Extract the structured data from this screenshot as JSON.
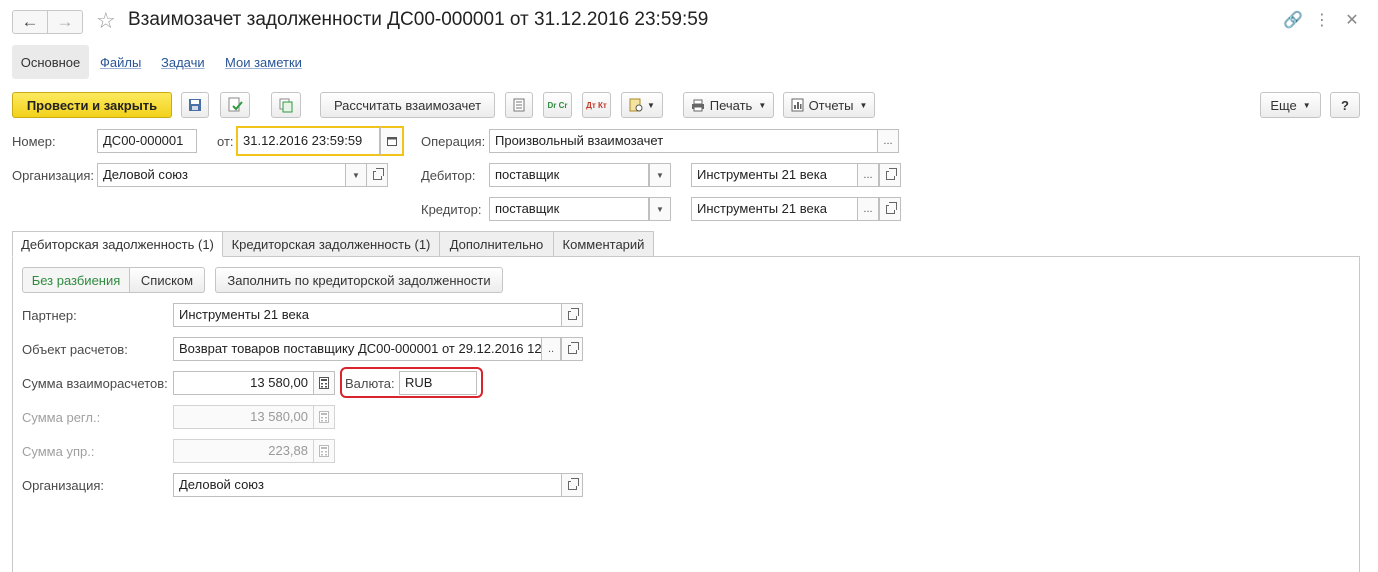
{
  "window": {
    "title": "Взаимозачет задолженности ДС00-000001 от 31.12.2016 23:59:59",
    "icons": [
      "link-icon",
      "more-icon",
      "close-icon"
    ]
  },
  "nav": {
    "main": "Основное",
    "links": [
      "Файлы",
      "Задачи",
      "Мои заметки"
    ]
  },
  "toolbar": {
    "post_close": "Провести и закрыть",
    "calculate": "Рассчитать взаимозачет",
    "dt_cr": "Dr Cr",
    "dt_kt": "Дт Кт",
    "print": "Печать",
    "reports": "Отчеты",
    "more": "Еще",
    "help": "?"
  },
  "header": {
    "number_label": "Номер:",
    "number": "ДС00-000001",
    "date_label": "от:",
    "date": "31.12.2016 23:59:59",
    "operation_label": "Операция:",
    "operation": "Произвольный взаимозачет",
    "org_label": "Организация:",
    "org": "Деловой союз",
    "debtor_label": "Дебитор:",
    "debtor_type": "поставщик",
    "debtor": "Инструменты 21 века",
    "creditor_label": "Кредитор:",
    "creditor_type": "поставщик",
    "creditor": "Инструменты 21 века"
  },
  "tabs": [
    {
      "label": "Дебиторская задолженность (1)",
      "active": true
    },
    {
      "label": "Кредиторская задолженность (1)",
      "active": false
    },
    {
      "label": "Дополнительно",
      "active": false
    },
    {
      "label": "Комментарий",
      "active": false
    }
  ],
  "panel": {
    "toggle_split": "Без разбиения",
    "toggle_list": "Списком",
    "fill_btn": "Заполнить по кредиторской задолженности",
    "partner_label": "Партнер:",
    "partner": "Инструменты 21 века",
    "object_label": "Объект расчетов:",
    "object": "Возврат товаров поставщику ДС00-000001 от 29.12.2016 12:",
    "sum_label": "Сумма взаиморасчетов:",
    "sum": "13 580,00",
    "currency_label": "Валюта:",
    "currency": "RUB",
    "sum_reg_label": "Сумма регл.:",
    "sum_reg": "13 580,00",
    "sum_mgmt_label": "Сумма упр.:",
    "sum_mgmt": "223,88",
    "org_label": "Организация:",
    "org": "Деловой союз"
  },
  "colors": {
    "primary_button": "#f3d21b",
    "highlight": "#d9232d",
    "link": "#2a5595",
    "active_toggle": "#2e8b3e"
  }
}
